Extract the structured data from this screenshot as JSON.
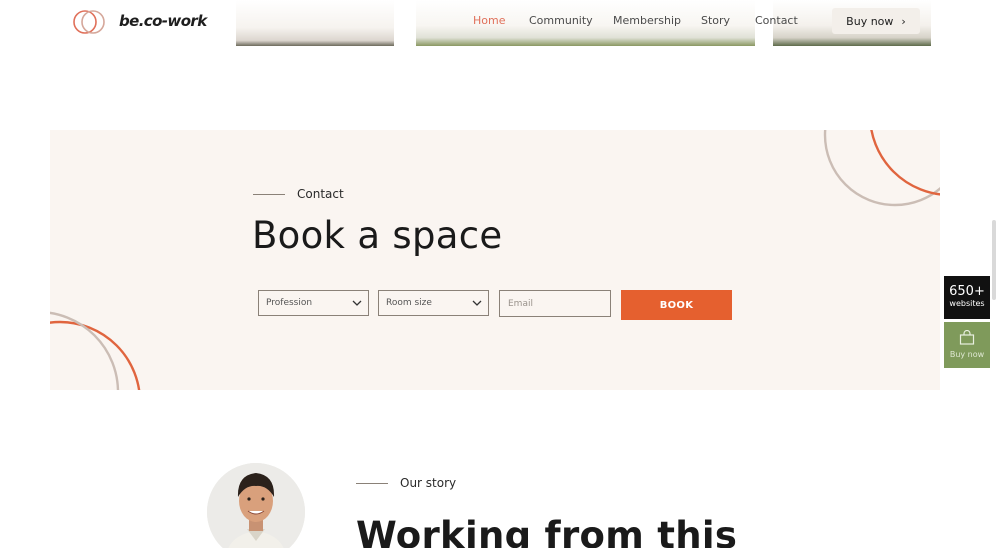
{
  "brand": {
    "name": "be.co-work"
  },
  "nav": {
    "items": [
      {
        "label": "Home",
        "active": true
      },
      {
        "label": "Community"
      },
      {
        "label": "Membership"
      },
      {
        "label": "Story"
      },
      {
        "label": "Contact"
      }
    ],
    "buy_label": "Buy now",
    "buy_icon": "chevron-right-icon"
  },
  "contact": {
    "eyebrow": "Contact",
    "heading": "Book a space",
    "profession": {
      "value": "Profession"
    },
    "room_size": {
      "value": "Room size"
    },
    "email": {
      "placeholder": "Email"
    },
    "book_label": "BOOK"
  },
  "side": {
    "count": "650+",
    "count_sub": "websites",
    "buy_label": "Buy now"
  },
  "story": {
    "eyebrow": "Our story",
    "heading": "Working from this"
  },
  "colors": {
    "accent": "#e5602f",
    "section_bg": "#faf5f1",
    "side_green": "#7f9a5b"
  }
}
